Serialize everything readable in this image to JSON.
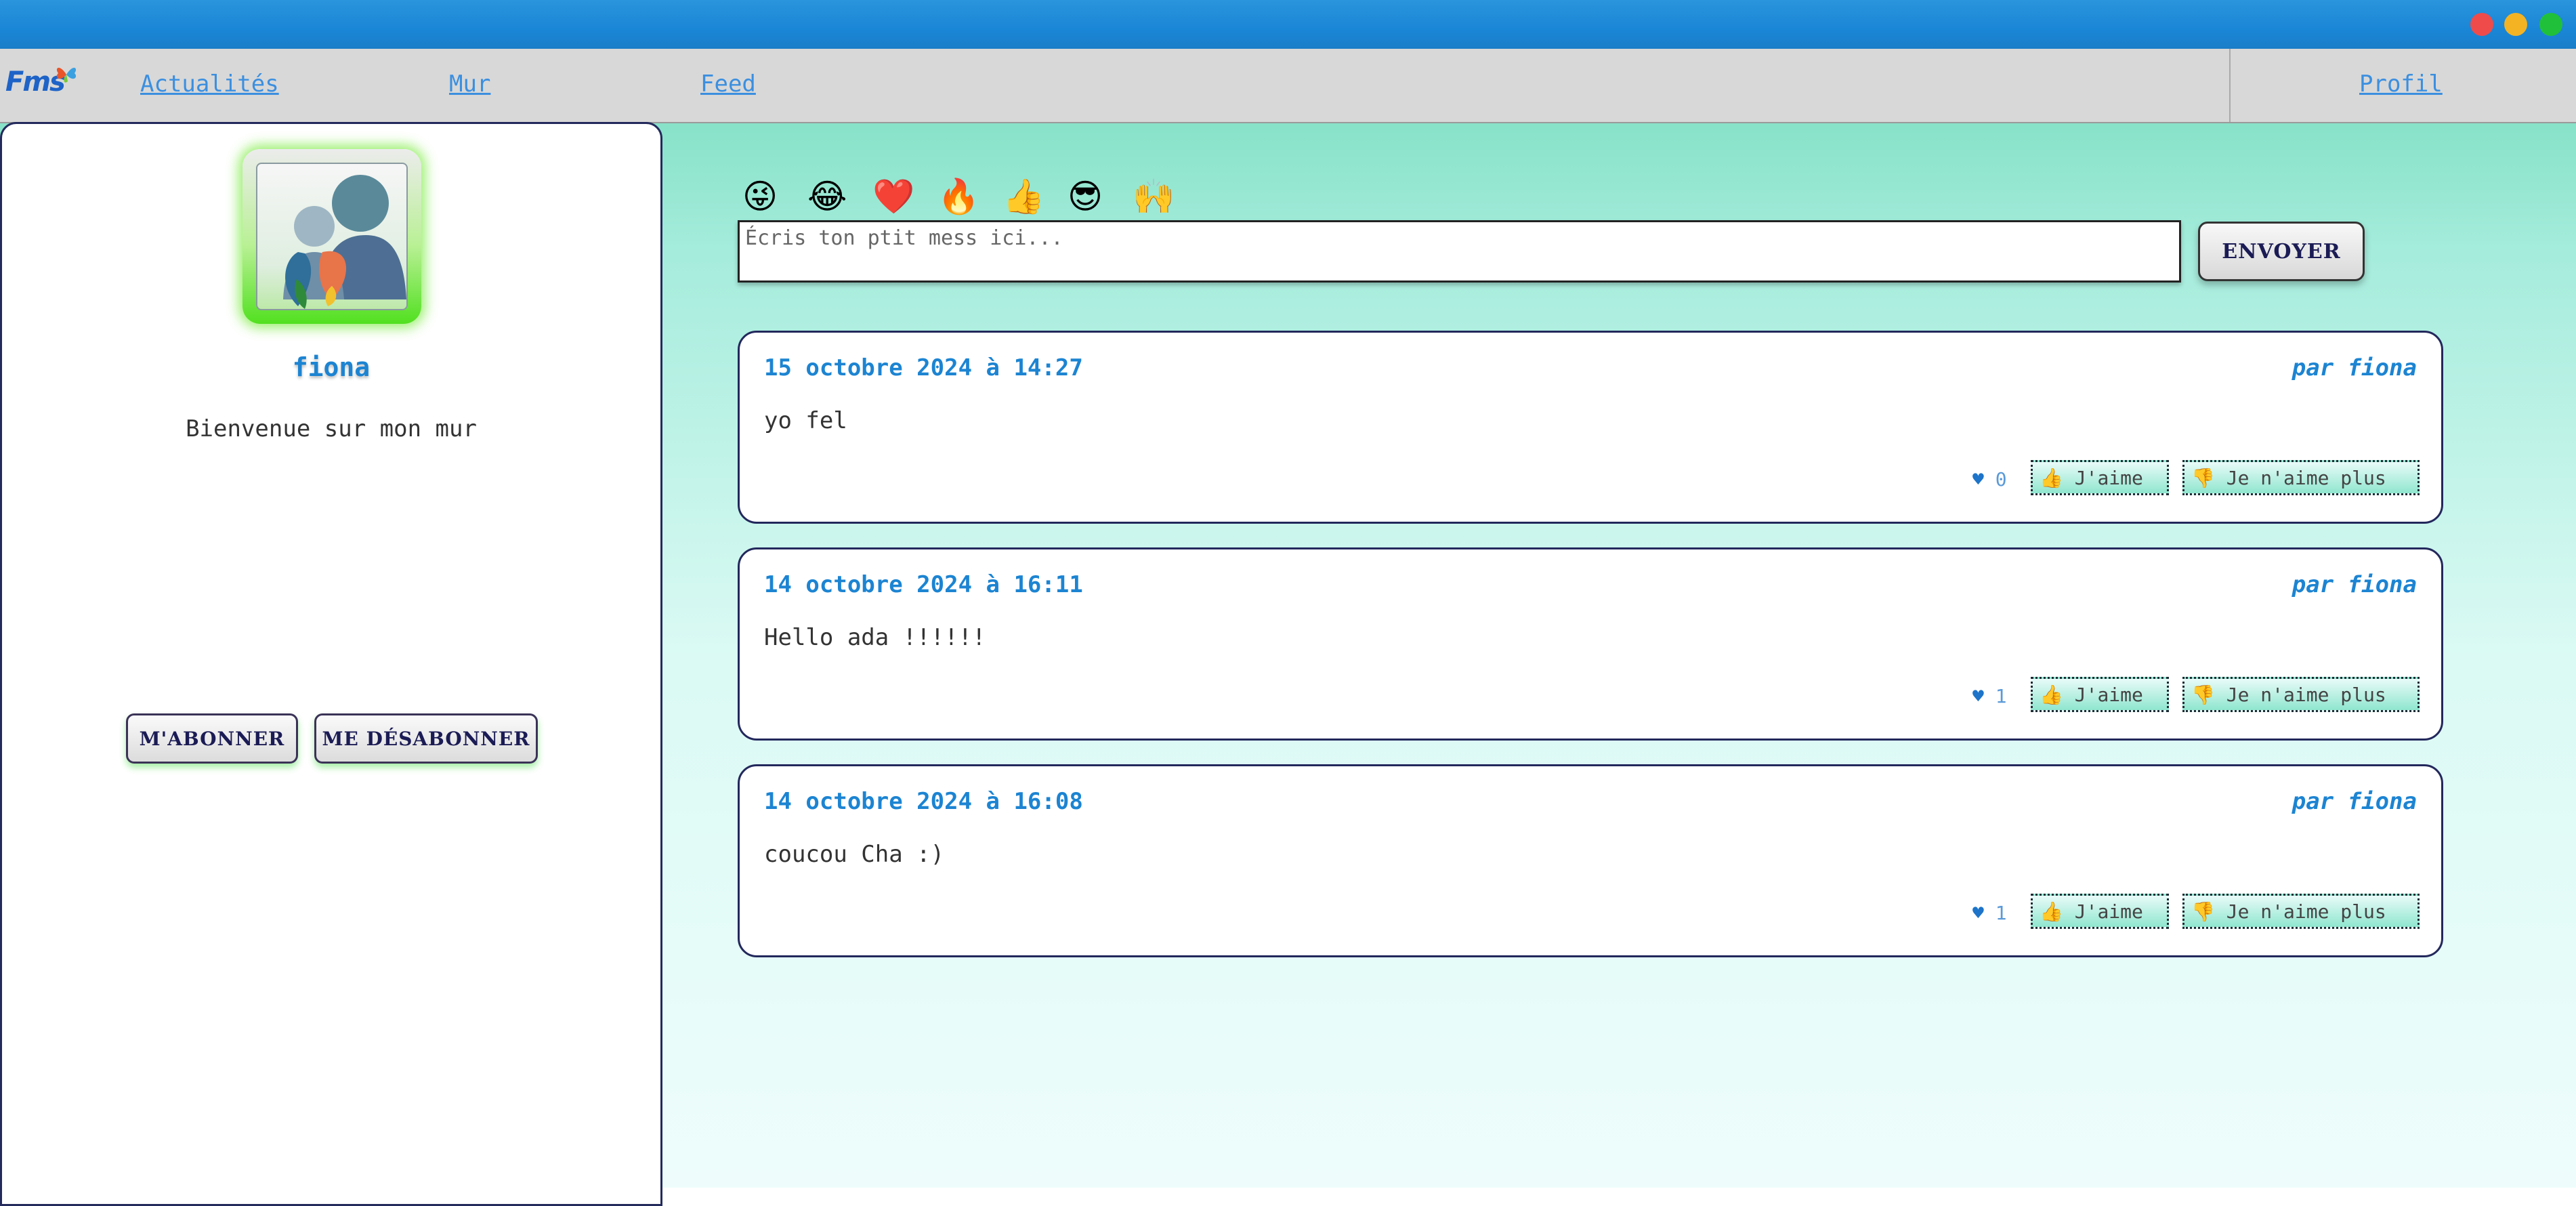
{
  "window": {
    "controls": [
      "close",
      "minimize",
      "maximize"
    ]
  },
  "nav": {
    "logo": "Fms",
    "links": [
      "Actualités",
      "Mur",
      "Feed"
    ],
    "profile": "Profil"
  },
  "sidebar": {
    "username": "fiona",
    "welcome": "Bienvenue sur mon mur",
    "subscribe_label": "M'ABONNER",
    "unsubscribe_label": "ME DÉSABONNER"
  },
  "composer": {
    "emojis": [
      "😜",
      "😂",
      "❤️",
      "🔥",
      "👍",
      "😎",
      "🙌"
    ],
    "placeholder": "Écris ton ptit mess ici...",
    "send_label": "ENVOYER"
  },
  "posts": [
    {
      "date": "15 octobre 2024 à 14:27",
      "author": "par fiona",
      "text": "yo fel",
      "likes": "0",
      "like_label": "J'aime",
      "unlike_label": "Je n'aime plus"
    },
    {
      "date": "14 octobre 2024 à 16:11",
      "author": "par fiona",
      "text": "Hello ada !!!!!!",
      "likes": "1",
      "like_label": "J'aime",
      "unlike_label": "Je n'aime plus"
    },
    {
      "date": "14 octobre 2024 à 16:08",
      "author": "par fiona",
      "text": "coucou Cha :)",
      "likes": "1",
      "like_label": "J'aime",
      "unlike_label": "Je n'aime plus"
    }
  ],
  "colors": {
    "accent": "#1c84d2",
    "titlebar": "#1a86d6",
    "border": "#23285c",
    "avatar_glow": "#52e020"
  }
}
